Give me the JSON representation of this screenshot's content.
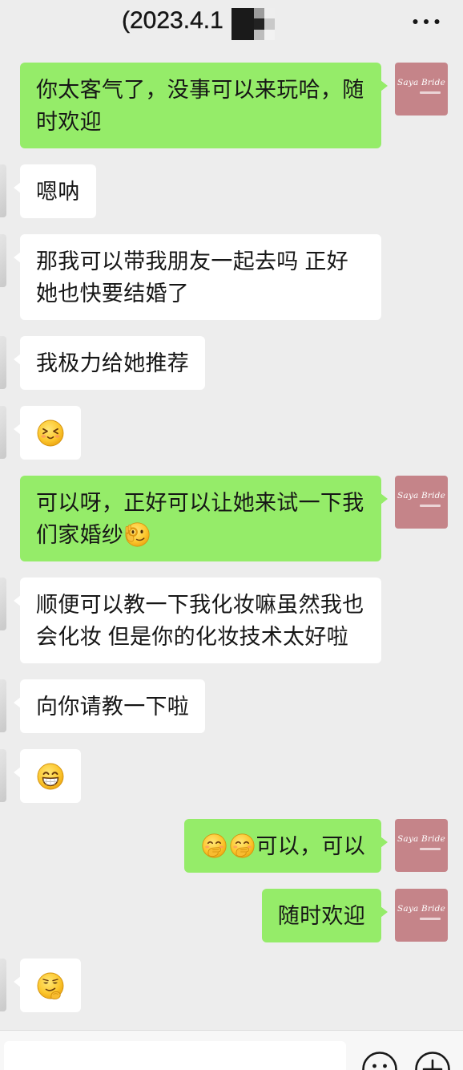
{
  "header": {
    "title": "(2023.4.1",
    "more_icon": "more-dots-icon"
  },
  "colors": {
    "background": "#ededed",
    "sent_bubble": "#95ec69",
    "received_bubble": "#ffffff",
    "logo_avatar": "#c58489",
    "text": "#161616"
  },
  "self_avatar": {
    "logo_text": "Saya Bride"
  },
  "messages": [
    {
      "from_me": true,
      "lines": [
        "你太客气了，没事可以来玩哈，随",
        "时欢迎"
      ]
    },
    {
      "from_me": false,
      "lines": [
        "嗯呐"
      ]
    },
    {
      "from_me": false,
      "lines": [
        "那我可以带我朋友一起去吗 正好",
        "她也快要结婚了"
      ]
    },
    {
      "from_me": false,
      "lines": [
        "我极力给她推荐"
      ]
    },
    {
      "from_me": false,
      "emoji": "shy-smile-emoji"
    },
    {
      "from_me": true,
      "lines": [
        "可以呀，正好可以让她来试一下我",
        "们家婚纱"
      ],
      "emoji_after": "ok-hand-face-emoji"
    },
    {
      "from_me": false,
      "lines": [
        "顺便可以教一下我化妆嘛虽然我也",
        "会化妆 但是你的化妆技术太好啦"
      ]
    },
    {
      "from_me": false,
      "lines": [
        "向你请教一下啦"
      ]
    },
    {
      "from_me": false,
      "emoji": "grinning-emoji"
    },
    {
      "from_me": true,
      "emojis_before": [
        "snicker-emoji",
        "snicker-emoji"
      ],
      "lines": [
        "可以，可以"
      ]
    },
    {
      "from_me": true,
      "lines": [
        "随时欢迎"
      ]
    },
    {
      "from_me": false,
      "emoji": "smirk-emoji"
    }
  ],
  "input_bar": {
    "value": "",
    "emoji_icon": "emoji-face-icon",
    "plus_icon": "plus-icon"
  }
}
